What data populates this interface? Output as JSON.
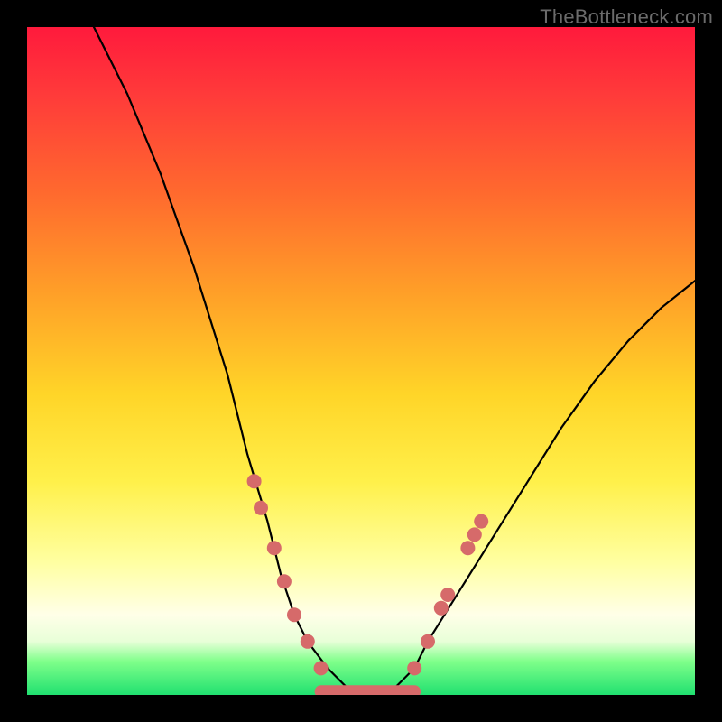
{
  "watermark": "TheBottleneck.com",
  "chart_data": {
    "type": "line",
    "title": "",
    "xlabel": "",
    "ylabel": "",
    "xlim": [
      0,
      100
    ],
    "ylim": [
      0,
      100
    ],
    "series": [
      {
        "name": "bottleneck-curve",
        "x": [
          10,
          15,
          20,
          25,
          30,
          33,
          36,
          38,
          40,
          42,
          45,
          48,
          50,
          52,
          55,
          58,
          60,
          65,
          70,
          75,
          80,
          85,
          90,
          95,
          100
        ],
        "y": [
          100,
          90,
          78,
          64,
          48,
          36,
          26,
          18,
          12,
          8,
          4,
          1,
          0,
          0,
          1,
          4,
          8,
          16,
          24,
          32,
          40,
          47,
          53,
          58,
          62
        ]
      }
    ],
    "markers": {
      "name": "highlight-dots",
      "color": "#d66a6a",
      "points": [
        {
          "x": 34,
          "y": 32
        },
        {
          "x": 35,
          "y": 28
        },
        {
          "x": 37,
          "y": 22
        },
        {
          "x": 38.5,
          "y": 17
        },
        {
          "x": 40,
          "y": 12
        },
        {
          "x": 42,
          "y": 8
        },
        {
          "x": 44,
          "y": 4
        },
        {
          "x": 58,
          "y": 4
        },
        {
          "x": 60,
          "y": 8
        },
        {
          "x": 62,
          "y": 13
        },
        {
          "x": 63,
          "y": 15
        },
        {
          "x": 66,
          "y": 22
        },
        {
          "x": 67,
          "y": 24
        },
        {
          "x": 68,
          "y": 26
        }
      ]
    },
    "flat_segment": {
      "name": "valley-floor",
      "color": "#d66a6a",
      "x_start": 44,
      "x_end": 58,
      "y": 0.5
    }
  }
}
